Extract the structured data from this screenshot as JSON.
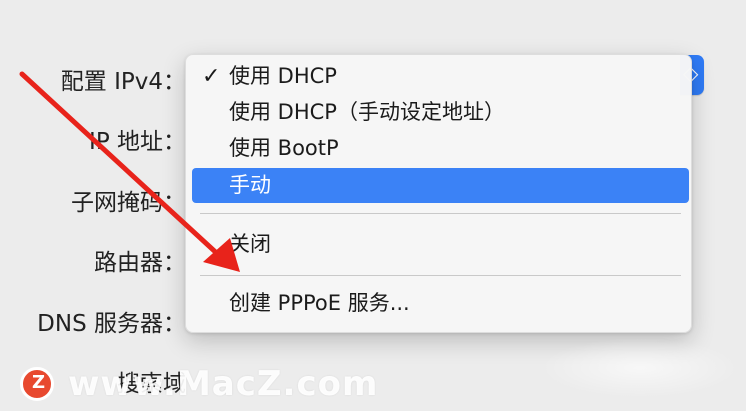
{
  "form": {
    "labels": [
      "配置 IPv4：",
      "IP 地址：",
      "子网掩码：",
      "路由器：",
      "DNS 服务器：",
      "搜索域"
    ]
  },
  "menu": {
    "items": [
      {
        "label": "使用 DHCP",
        "checked": true
      },
      {
        "label": "使用 DHCP（手动设定地址）",
        "checked": false
      },
      {
        "label": "使用 BootP",
        "checked": false
      },
      {
        "label": "手动",
        "highlighted": true
      }
    ],
    "check_mark": "✓",
    "secondary": {
      "label": "关闭"
    },
    "tertiary": {
      "label": "创建 PPPoE 服务..."
    }
  },
  "field_button": {
    "glyph": "◇"
  },
  "watermark": {
    "text": "www.MacZ.com",
    "logo_letter": "Z"
  },
  "colors": {
    "highlight": "#3b82f6",
    "arrow": "#e8231b",
    "accent_button": "#2f7bf6"
  }
}
